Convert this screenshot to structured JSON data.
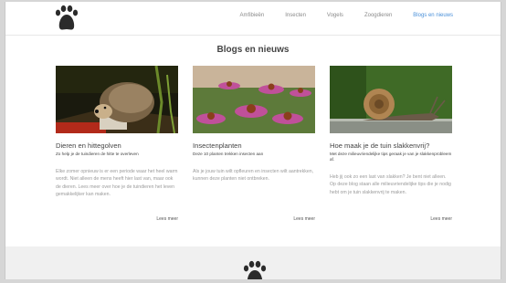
{
  "nav": {
    "items": [
      {
        "label": "Amfibieën",
        "active": false
      },
      {
        "label": "Insecten",
        "active": false
      },
      {
        "label": "Vogels",
        "active": false
      },
      {
        "label": "Zoogdieren",
        "active": false
      },
      {
        "label": "Blogs en nieuws",
        "active": true
      }
    ]
  },
  "main": {
    "title": "Blogs en nieuws",
    "cards": [
      {
        "image": "hedgehog-photo",
        "title": "Dieren en hittegolven",
        "subtitle": "Zo help je de tuindieren de hitte te overleven",
        "body": "Elke zomer opnieuw is er een periode waar het heel warm wordt. Niet alleen de mens heeft hier last van, maar ook de dieren. Lees meer over hoe je de tuindieren het leven gemakkelijker kan maken.",
        "more": "Lees meer"
      },
      {
        "image": "coneflowers-photo",
        "title": "Insectenplanten",
        "subtitle": "Deze 10 planten trekken insecten aan",
        "body": "Als je jouw tuin wilt opfleuren en insecten wilt aantrekken, kunnen deze planten niet ontbreken.",
        "more": "Lees meer"
      },
      {
        "image": "snail-photo",
        "title": "Hoe maak je de tuin slakkenvrij?",
        "subtitle": "Met deze milieuvriendelijke tips geraak je van je slakkenprobleem af.",
        "body": "Heb jij ook zo een last van slakken? Je bent niet alleen. Op deze blog staan alle milieuvriendelijke tips die je nodig hebt om je tuin slakkenvrij te maken.",
        "more": "Lees meer"
      }
    ]
  },
  "colors": {
    "accent": "#4a90d9",
    "footer_bg": "#f0f0f0",
    "logo": "#2b2b2b"
  }
}
